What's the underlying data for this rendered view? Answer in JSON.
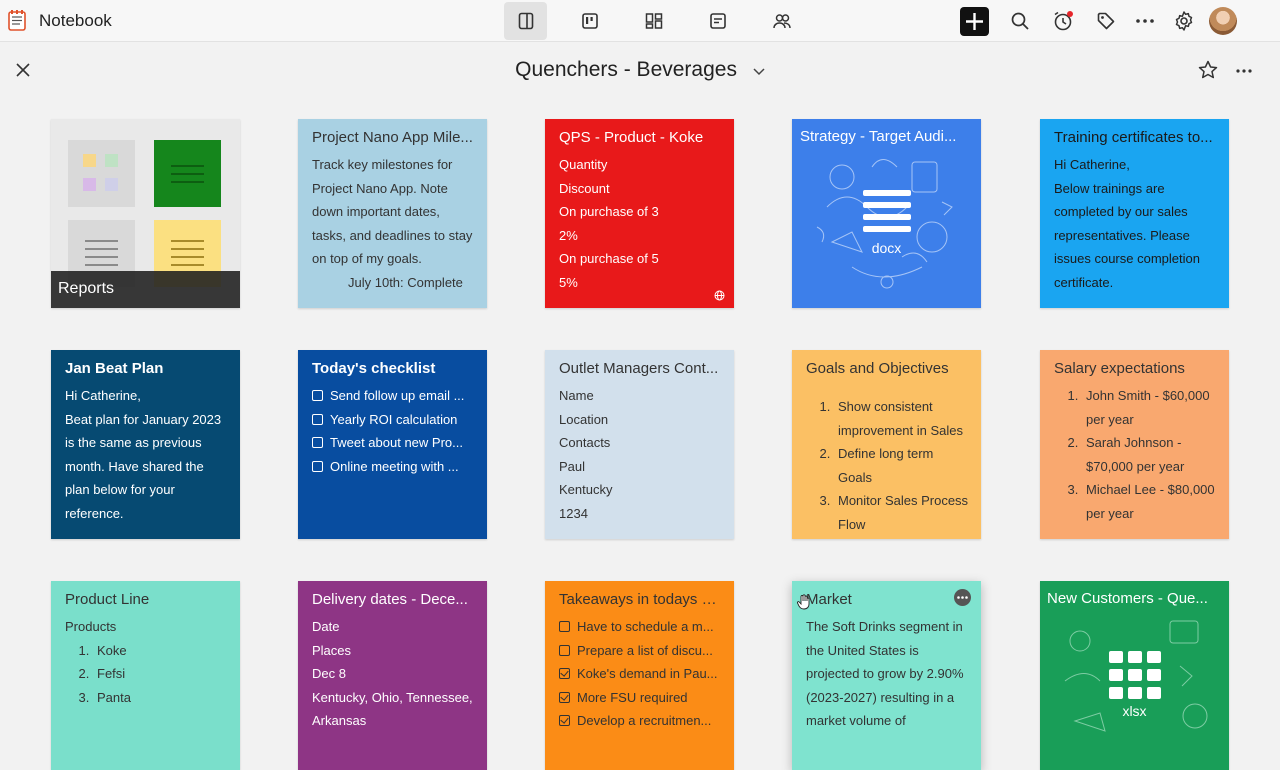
{
  "app": {
    "title": "Notebook"
  },
  "notebook": {
    "title": "Quenchers - Beverages"
  },
  "colors": {
    "accent": "#111111",
    "background": "#f2f2f2"
  },
  "icons": {
    "view_tabs": [
      "sidebar-toggle-icon",
      "board-icon",
      "grid-icon",
      "note-icon",
      "collaborators-icon"
    ],
    "tools": [
      "add-icon",
      "search-icon",
      "reminder-icon",
      "tag-icon",
      "more-icon",
      "settings-icon",
      "avatar"
    ]
  },
  "cards": {
    "reports": {
      "label": "Reports"
    },
    "project_nano": {
      "title": "Project Nano App Mile...",
      "body": "Track key milestones for Project Nano App. Note down important dates, tasks, and deadlines to stay on top of my goals.",
      "bullet": "July 10th: Complete",
      "bg": "#a9d1e3"
    },
    "qps": {
      "title": "QPS - Product - Koke",
      "lines": [
        "Quantity",
        "Discount",
        "On purchase of 3",
        "2%",
        "On purchase of 5",
        "5%"
      ],
      "bg": "#e8191a"
    },
    "strategy": {
      "title": "Strategy - Target Audi...",
      "file_type": "docx",
      "bg": "#3d7fea"
    },
    "training": {
      "title": "Training certificates to...",
      "lines": [
        "Hi Catherine,",
        "Below trainings are completed by our sales representatives. Please issues course completion certificate."
      ],
      "bg": "#1aa5f1"
    },
    "jan_beat": {
      "title": "Jan Beat Plan",
      "lines": [
        "Hi Catherine,",
        "Beat plan for January 2023 is the same as previous month. Have shared the plan below for your reference."
      ],
      "bg": "#064a72"
    },
    "checklist": {
      "title": "Today's checklist",
      "items": [
        "Send follow up email ...",
        "Yearly ROI calculation",
        "Tweet about new Pro...",
        "Online meeting with ..."
      ],
      "bg": "#084da0"
    },
    "outlet": {
      "title": "Outlet Managers Cont...",
      "lines": [
        "Name",
        "Location",
        "Contacts",
        "Paul",
        "Kentucky",
        "1234"
      ],
      "bg": "#d2e0ec"
    },
    "goals": {
      "title": "Goals and Objectives",
      "items": [
        "Show consistent improvement in Sales",
        "Define long term Goals",
        "Monitor Sales Process Flow"
      ],
      "bg": "#fbc064"
    },
    "salary": {
      "title": "Salary expectations",
      "items": [
        "John Smith - $60,000 per year",
        "Sarah Johnson - $70,000 per year",
        "Michael Lee - $80,000 per year"
      ],
      "bg": "#f9a86f"
    },
    "product_line": {
      "title": "Product Line",
      "lines": [
        "Products"
      ],
      "items": [
        "Koke",
        "Fefsi",
        "Panta"
      ],
      "bg": "#7adfcb"
    },
    "delivery": {
      "title": "Delivery dates - Dece...",
      "lines": [
        "Date",
        "Places",
        "Dec 8",
        "Kentucky, Ohio, Tennessee,",
        "Arkansas"
      ],
      "bg": "#8e3585"
    },
    "takeaways": {
      "title": "Takeaways in todays M...",
      "items": [
        {
          "text": "Have to schedule a m...",
          "checked": false
        },
        {
          "text": "Prepare a list of discu...",
          "checked": false
        },
        {
          "text": "Koke's demand in Pau...",
          "checked": true
        },
        {
          "text": "More FSU required",
          "checked": true
        },
        {
          "text": "Develop a recruitmen...",
          "checked": true
        }
      ],
      "bg": "#fb8c16"
    },
    "market": {
      "title": "Market",
      "body": "The Soft Drinks segment in the United States is projected to grow by 2.90% (2023-2027) resulting in a market volume of",
      "bg": "#7fe3cf"
    },
    "new_customers": {
      "title": "New Customers - Que...",
      "file_type": "xlsx",
      "bg": "#199e58"
    }
  }
}
